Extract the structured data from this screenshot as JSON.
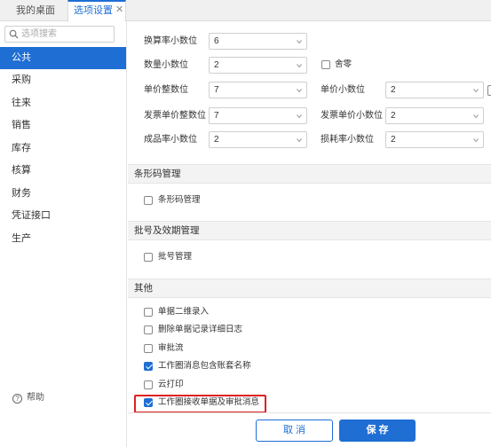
{
  "tabs": {
    "home": "我的桌面",
    "active": "选项设置",
    "close": "✕"
  },
  "sidebar": {
    "search_placeholder": "选项搜索",
    "items": [
      "公共",
      "采购",
      "往来",
      "销售",
      "库存",
      "核算",
      "财务",
      "凭证接口",
      "生产"
    ],
    "active_index": 0,
    "help": "帮助"
  },
  "precision": {
    "conversion_decimals": {
      "label": "换算率小数位",
      "value": "6"
    },
    "qty_decimals": {
      "label": "数量小数位",
      "value": "2"
    },
    "round_off": {
      "label": "舍零",
      "checked": false
    },
    "price_integer": {
      "label": "单价整数位",
      "value": "7"
    },
    "price_decimals": {
      "label": "单价小数位",
      "value": "2"
    },
    "invoice_price_integer": {
      "label": "发票单价整数位",
      "value": "7"
    },
    "invoice_price_decimals": {
      "label": "发票单价小数位",
      "value": "2"
    },
    "yield_decimals": {
      "label": "成品率小数位",
      "value": "2"
    },
    "loss_decimals": {
      "label": "损耗率小数位",
      "value": "2"
    }
  },
  "barcode": {
    "title": "条形码管理",
    "items": [
      {
        "label": "条形码管理",
        "checked": false
      }
    ]
  },
  "batch": {
    "title": "批号及效期管理",
    "items": [
      {
        "label": "批号管理",
        "checked": false
      }
    ]
  },
  "other": {
    "title": "其他",
    "items": [
      {
        "label": "单据二维录入",
        "checked": false
      },
      {
        "label": "删除单据记录详细日志",
        "checked": false
      },
      {
        "label": "审批流",
        "checked": false
      },
      {
        "label": "工作圈消息包含账套名称",
        "checked": true
      },
      {
        "label": "云打印",
        "checked": false
      },
      {
        "label": "工作圈接收单据及审批消息",
        "checked": true
      }
    ]
  },
  "footer": {
    "cancel": "取 消",
    "save": "保 存"
  },
  "colors": {
    "accent": "#1f6ed4",
    "highlight": "#e02020"
  }
}
